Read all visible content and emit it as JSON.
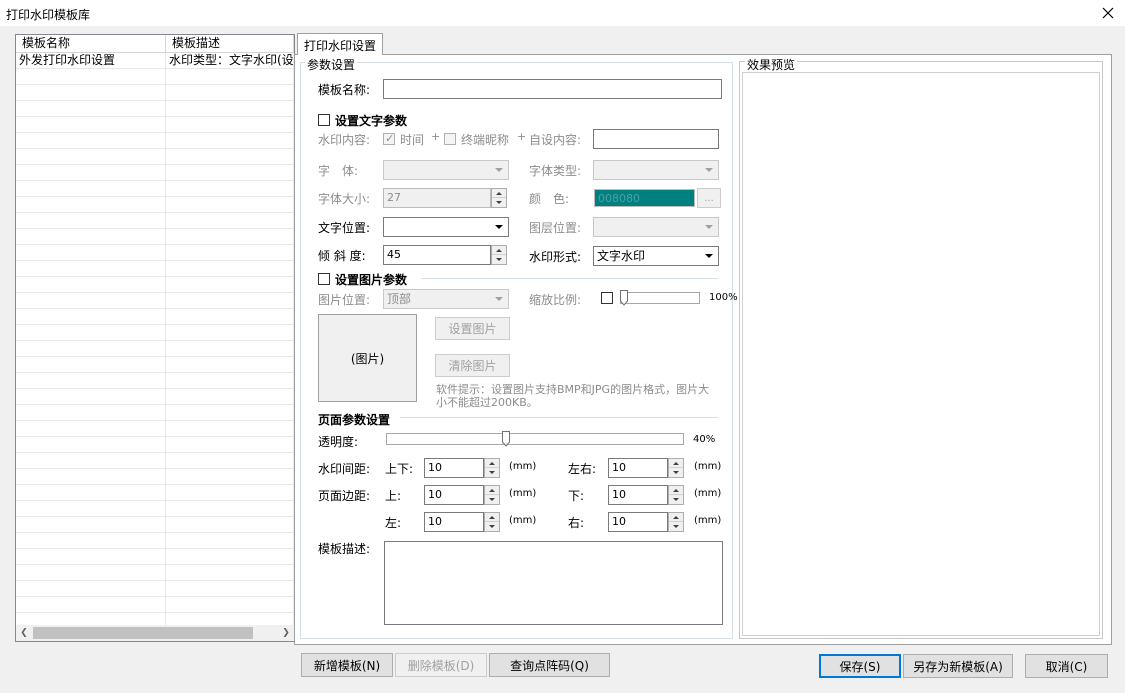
{
  "window": {
    "title": "打印水印模板库"
  },
  "list": {
    "columns": [
      "模板名称",
      "模板描述"
    ],
    "rows": [
      [
        "外发打印水印设置",
        "水印类型：文字水印(设"
      ]
    ]
  },
  "tab": {
    "label": "打印水印设置"
  },
  "params": {
    "group_title": "参数设置",
    "template_name_label": "模板名称:",
    "template_name_value": "",
    "text_section": "设置文字参数",
    "wm_content_label": "水印内容:",
    "plus": "+",
    "time_label": "时间",
    "terminal_label": "终端昵称",
    "custom_label": "自设内容:",
    "font_label": "字　体:",
    "font_type_label": "字体类型:",
    "font_size_label": "字体大小:",
    "font_size_value": "27",
    "color_label": "颜　色:",
    "color_value": "008080",
    "color_hex": "#008080",
    "color_button": "...",
    "text_pos_label": "文字位置:",
    "layer_pos_label": "图层位置:",
    "tilt_label": "倾 斜 度:",
    "tilt_value": "45",
    "wm_form_label": "水印形式:",
    "wm_form_value": "文字水印",
    "image_section": "设置图片参数",
    "img_pos_label": "图片位置:",
    "img_pos_value": "顶部",
    "scale_label": "缩放比例:",
    "scale_value": "100%",
    "scale_fraction": 0.0,
    "image_placeholder": "(图片)",
    "set_image_button": "设置图片",
    "clear_image_button": "清除图片",
    "hint": "软件提示：设置图片支持BMP和JPG的图片格式，图片大小不能超过200KB。",
    "page_section": "页面参数设置",
    "opacity_label": "透明度:",
    "opacity_value": "40%",
    "opacity_fraction": 0.4,
    "wm_spacing_label": "水印间距:",
    "updown_label": "上下:",
    "leftright_label": "左右:",
    "page_margin_label": "页面边距:",
    "top_label": "上:",
    "bottom_label": "下:",
    "left_label": "左:",
    "right_label": "右:",
    "unit": "(mm)",
    "spacing_updown": "10",
    "spacing_leftright": "10",
    "margin_top": "10",
    "margin_bottom": "10",
    "margin_left": "10",
    "margin_right": "10",
    "desc_label": "模板描述:",
    "desc_value": ""
  },
  "preview": {
    "group_title": "效果预览"
  },
  "buttons": {
    "add": "新增模板(N)",
    "delete": "删除模板(D)",
    "query": "查询点阵码(Q)",
    "save": "保存(S)",
    "save_as": "另存为新模板(A)",
    "cancel": "取消(C)"
  },
  "icons": {
    "close": "close-icon",
    "dropdown": "chevron-down-icon",
    "spin": "spinner-arrows-icon",
    "check": "checkmark-icon"
  }
}
